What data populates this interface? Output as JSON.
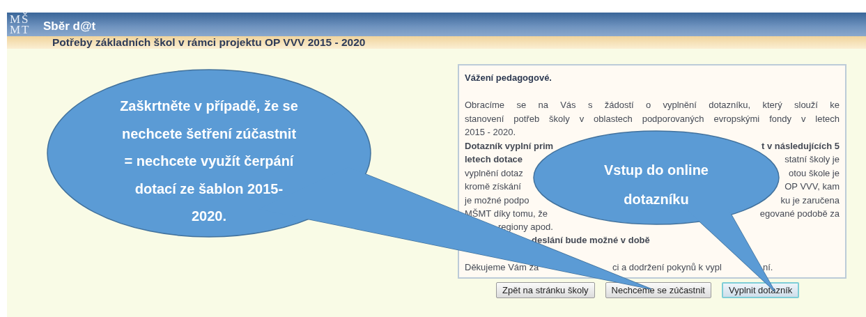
{
  "header": {
    "logo": "MŠMT",
    "title": "Sběr d@t"
  },
  "subtitle": "Potřeby základních škol v rámci projektu OP VVV 2015 - 2020",
  "panel": {
    "lines": [
      {
        "kind": "heading",
        "parts": [
          "Vážení pedagogové."
        ]
      },
      {
        "kind": "blank"
      },
      {
        "kind": "justified",
        "parts": [
          "Obracíme se na Vás s žádostí o vyplnění dotazníku, který slouží ke"
        ]
      },
      {
        "kind": "justified",
        "parts": [
          "stanovení potřeb školy v oblastech podporovaných evropskými fondy v letech"
        ]
      },
      {
        "kind": "plain",
        "parts": [
          "2015 - 2020."
        ]
      },
      {
        "kind": "split",
        "parts": [
          "**Dotazník vyplní prim**",
          "**t v následujících 5**"
        ]
      },
      {
        "kind": "split",
        "parts": [
          "**letech dotace**",
          "statní školy je"
        ]
      },
      {
        "kind": "split",
        "parts": [
          "vyplnění dotaz",
          "otou škole je"
        ]
      },
      {
        "kind": "split",
        "parts": [
          "kromě získání",
          "OP VVV, kam"
        ]
      },
      {
        "kind": "split",
        "parts": [
          "je možné podpo",
          "ku je zaručena"
        ]
      },
      {
        "kind": "split",
        "parts": [
          "MŠMT díky tomu, že",
          "egované podobě za"
        ]
      },
      {
        "kind": "offset",
        "parts": [
          "regiony apod."
        ]
      },
      {
        "kind": "offset",
        "parts": [
          "**deslání bude možné v době**"
        ]
      },
      {
        "kind": "blank"
      },
      {
        "kind": "offset",
        "parts": [
          "Děkujeme Vám za",
          "ci a dodržení pokynů k vypl",
          "ní."
        ]
      }
    ]
  },
  "buttons": [
    {
      "label": "Zpět na stránku školy",
      "focused": false
    },
    {
      "label": "Nechceme se zúčastnit",
      "focused": false
    },
    {
      "label": "Vyplnit dotazník",
      "focused": true
    }
  ],
  "callouts": [
    {
      "lines": [
        "Zaškrtněte v případě, že se",
        "nechcete šetření zúčastnit",
        "= nechcete využít čerpání",
        "dotací ze šablon 2015-",
        "2020."
      ],
      "kind": "large"
    },
    {
      "lines": [
        "Vstup do online",
        "dotazníku"
      ],
      "kind": "small"
    }
  ]
}
